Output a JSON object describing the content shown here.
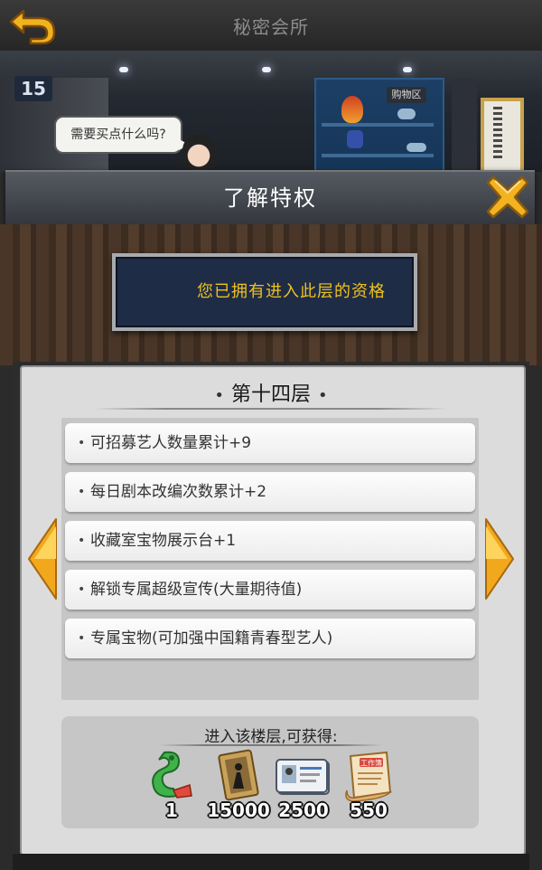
{
  "header": {
    "title": "秘密会所",
    "back_icon": "back-arrow-icon"
  },
  "scene": {
    "floor_number": "15",
    "shop_sign": "购物区",
    "npc_speech": "需要买点什么吗?"
  },
  "privilege": {
    "title": "了解特权",
    "qualification": "您已拥有进入此层的资格"
  },
  "floor": {
    "name": "第十四层",
    "benefits": [
      "可招募艺人数量累计+9",
      "每日剧本改编次数累计+2",
      "收藏室宝物展示台+1",
      "解锁专属超级宣传(大量期待值)",
      "专属宝物(可加强中国籍青春型艺人)"
    ]
  },
  "rewards": {
    "heading": "进入该楼层,可获得:",
    "items": [
      {
        "icon": "jade-dragon-icon",
        "amount": "1"
      },
      {
        "icon": "film-poster-icon",
        "amount": "15000"
      },
      {
        "icon": "id-card-icon",
        "amount": "2500"
      },
      {
        "icon": "work-scroll-icon",
        "amount": "550",
        "icon_text": "工作簿"
      }
    ]
  },
  "colors": {
    "accent_gold": "#f0c21e",
    "arrow_orange": "#f2a81d",
    "panel_bg": "#dcdcdc"
  }
}
